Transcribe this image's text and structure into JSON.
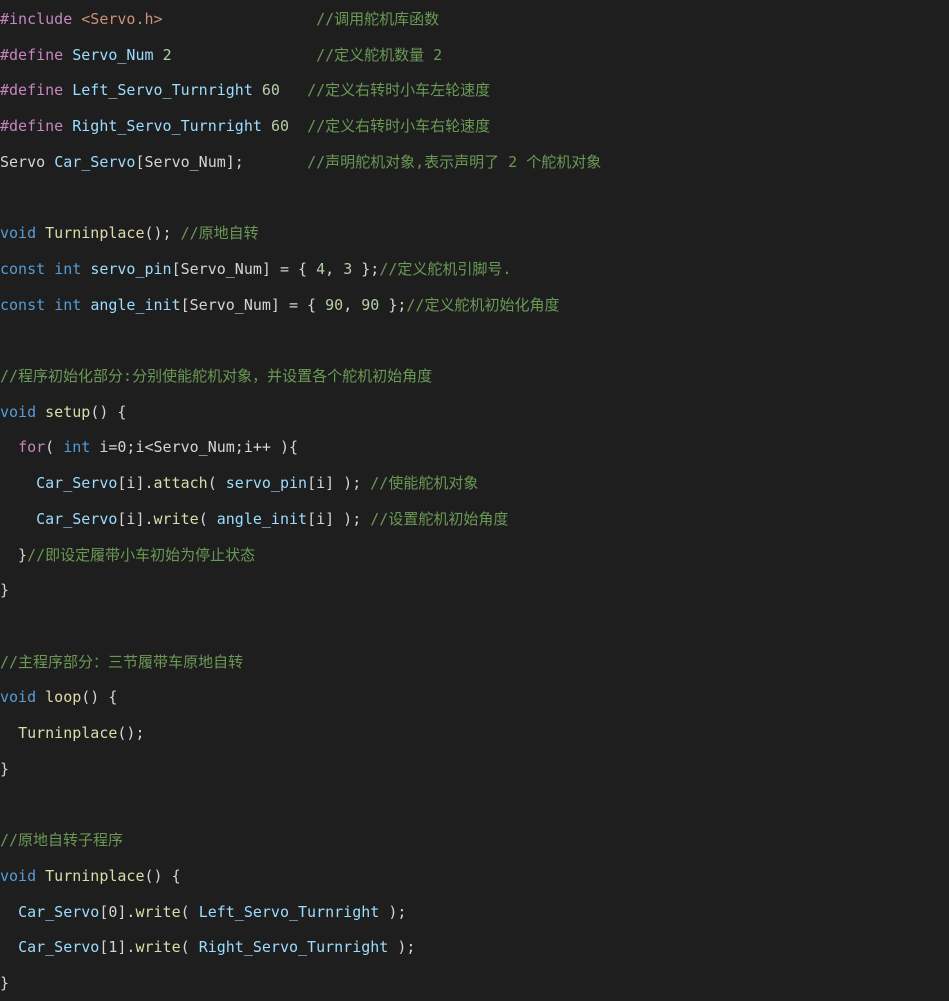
{
  "code": {
    "lines": [
      [
        {
          "t": "#include",
          "c": "dir"
        },
        {
          "t": " ",
          "c": "pl"
        },
        {
          "t": "<Servo.h>",
          "c": "str"
        },
        {
          "t": "                 ",
          "c": "pl"
        },
        {
          "t": "//调用舵机库函数",
          "c": "cm"
        }
      ],
      [
        {
          "t": "#define",
          "c": "dir"
        },
        {
          "t": " ",
          "c": "pl"
        },
        {
          "t": "Servo_Num",
          "c": "var"
        },
        {
          "t": " ",
          "c": "pl"
        },
        {
          "t": "2",
          "c": "num"
        },
        {
          "t": "                ",
          "c": "pl"
        },
        {
          "t": "//定义舵机数量 2",
          "c": "cm"
        }
      ],
      [
        {
          "t": "#define",
          "c": "dir"
        },
        {
          "t": " ",
          "c": "pl"
        },
        {
          "t": "Left_Servo_Turnright",
          "c": "var"
        },
        {
          "t": " ",
          "c": "pl"
        },
        {
          "t": "60",
          "c": "num"
        },
        {
          "t": "   ",
          "c": "pl"
        },
        {
          "t": "//定义右转时小车左轮速度",
          "c": "cm"
        }
      ],
      [
        {
          "t": "#define",
          "c": "dir"
        },
        {
          "t": " ",
          "c": "pl"
        },
        {
          "t": "Right_Servo_Turnright",
          "c": "var"
        },
        {
          "t": " ",
          "c": "pl"
        },
        {
          "t": "60",
          "c": "num"
        },
        {
          "t": "  ",
          "c": "pl"
        },
        {
          "t": "//定义右转时小车右轮速度",
          "c": "cm"
        }
      ],
      [
        {
          "t": "Servo",
          "c": "pl"
        },
        {
          "t": " ",
          "c": "pl"
        },
        {
          "t": "Car_Servo",
          "c": "var"
        },
        {
          "t": "[Servo_Num];",
          "c": "pl"
        },
        {
          "t": "       ",
          "c": "pl"
        },
        {
          "t": "//声明舵机对象,表示声明了 2 个舵机对象",
          "c": "cm"
        }
      ],
      [],
      [
        {
          "t": "void",
          "c": "kw"
        },
        {
          "t": " ",
          "c": "pl"
        },
        {
          "t": "Turninplace",
          "c": "fn"
        },
        {
          "t": "(); ",
          "c": "pl"
        },
        {
          "t": "//原地自转",
          "c": "cm"
        }
      ],
      [
        {
          "t": "const",
          "c": "kw"
        },
        {
          "t": " ",
          "c": "pl"
        },
        {
          "t": "int",
          "c": "kw"
        },
        {
          "t": " ",
          "c": "pl"
        },
        {
          "t": "servo_pin",
          "c": "var"
        },
        {
          "t": "[Servo_Num] = { ",
          "c": "pl"
        },
        {
          "t": "4",
          "c": "num"
        },
        {
          "t": ", ",
          "c": "pl"
        },
        {
          "t": "3",
          "c": "num"
        },
        {
          "t": " };",
          "c": "pl"
        },
        {
          "t": "//定义舵机引脚号.",
          "c": "cm"
        }
      ],
      [
        {
          "t": "const",
          "c": "kw"
        },
        {
          "t": " ",
          "c": "pl"
        },
        {
          "t": "int",
          "c": "kw"
        },
        {
          "t": " ",
          "c": "pl"
        },
        {
          "t": "angle_init",
          "c": "var"
        },
        {
          "t": "[Servo_Num] = { ",
          "c": "pl"
        },
        {
          "t": "90",
          "c": "num"
        },
        {
          "t": ", ",
          "c": "pl"
        },
        {
          "t": "90",
          "c": "num"
        },
        {
          "t": " };",
          "c": "pl"
        },
        {
          "t": "//定义舵机初始化角度",
          "c": "cm"
        }
      ],
      [],
      [
        {
          "t": "//程序初始化部分:分别使能舵机对象，并设置各个舵机初始角度",
          "c": "cm"
        }
      ],
      [
        {
          "t": "void",
          "c": "kw"
        },
        {
          "t": " ",
          "c": "pl"
        },
        {
          "t": "setup",
          "c": "fn"
        },
        {
          "t": "() {",
          "c": "pl"
        }
      ],
      [
        {
          "t": "  ",
          "c": "pl"
        },
        {
          "t": "for",
          "c": "ctl"
        },
        {
          "t": "( ",
          "c": "pl"
        },
        {
          "t": "int",
          "c": "kw"
        },
        {
          "t": " i=0;i<Servo_Num;i++ ){",
          "c": "pl"
        }
      ],
      [
        {
          "t": "    ",
          "c": "pl"
        },
        {
          "t": "Car_Servo",
          "c": "var"
        },
        {
          "t": "[i].",
          "c": "pl"
        },
        {
          "t": "attach",
          "c": "fn"
        },
        {
          "t": "( ",
          "c": "pl"
        },
        {
          "t": "servo_pin",
          "c": "var"
        },
        {
          "t": "[i] ); ",
          "c": "pl"
        },
        {
          "t": "//使能舵机对象",
          "c": "cm"
        }
      ],
      [
        {
          "t": "    ",
          "c": "pl"
        },
        {
          "t": "Car_Servo",
          "c": "var"
        },
        {
          "t": "[i].",
          "c": "pl"
        },
        {
          "t": "write",
          "c": "fn"
        },
        {
          "t": "( ",
          "c": "pl"
        },
        {
          "t": "angle_init",
          "c": "var"
        },
        {
          "t": "[i] ); ",
          "c": "pl"
        },
        {
          "t": "//设置舵机初始角度",
          "c": "cm"
        }
      ],
      [
        {
          "t": "  }",
          "c": "pl"
        },
        {
          "t": "//即设定履带小车初始为停止状态",
          "c": "cm"
        }
      ],
      [
        {
          "t": "}",
          "c": "pl"
        }
      ],
      [],
      [
        {
          "t": "//主程序部分：三节履带车原地自转",
          "c": "cm"
        }
      ],
      [
        {
          "t": "void",
          "c": "kw"
        },
        {
          "t": " ",
          "c": "pl"
        },
        {
          "t": "loop",
          "c": "fn"
        },
        {
          "t": "() {",
          "c": "pl"
        }
      ],
      [
        {
          "t": "  ",
          "c": "pl"
        },
        {
          "t": "Turninplace",
          "c": "fn"
        },
        {
          "t": "();",
          "c": "pl"
        }
      ],
      [
        {
          "t": "}",
          "c": "pl"
        }
      ],
      [],
      [
        {
          "t": "//原地自转子程序",
          "c": "cm"
        }
      ],
      [
        {
          "t": "void",
          "c": "kw"
        },
        {
          "t": " ",
          "c": "pl"
        },
        {
          "t": "Turninplace",
          "c": "fn"
        },
        {
          "t": "() {",
          "c": "pl"
        }
      ],
      [
        {
          "t": "  ",
          "c": "pl"
        },
        {
          "t": "Car_Servo",
          "c": "var"
        },
        {
          "t": "[0].",
          "c": "pl"
        },
        {
          "t": "write",
          "c": "fn"
        },
        {
          "t": "( ",
          "c": "pl"
        },
        {
          "t": "Left_Servo_Turnright",
          "c": "var"
        },
        {
          "t": " );",
          "c": "pl"
        }
      ],
      [
        {
          "t": "  ",
          "c": "pl"
        },
        {
          "t": "Car_Servo",
          "c": "var"
        },
        {
          "t": "[1].",
          "c": "pl"
        },
        {
          "t": "write",
          "c": "fn"
        },
        {
          "t": "( ",
          "c": "pl"
        },
        {
          "t": "Right_Servo_Turnright",
          "c": "var"
        },
        {
          "t": " );",
          "c": "pl"
        }
      ],
      [
        {
          "t": "}",
          "c": "pl"
        }
      ]
    ]
  }
}
